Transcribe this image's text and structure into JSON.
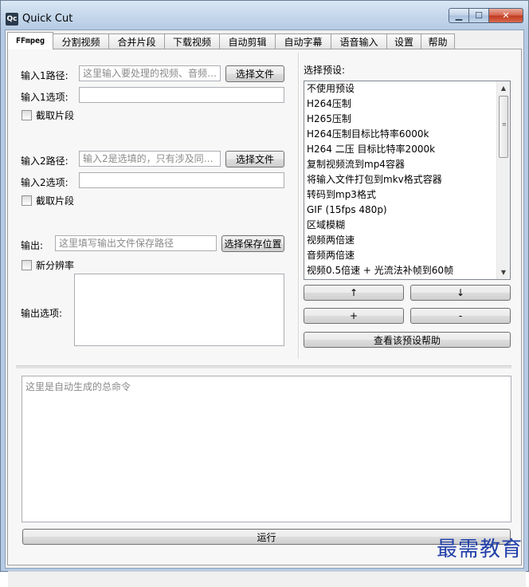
{
  "window": {
    "title": "Quick Cut",
    "app_icon": "Qc",
    "controls": {
      "minimize": "▁",
      "maximize": "☐",
      "close": "✕"
    }
  },
  "tabs": [
    {
      "label": "FFmpeg"
    },
    {
      "label": "分割视频"
    },
    {
      "label": "合并片段"
    },
    {
      "label": "下载视频"
    },
    {
      "label": "自动剪辑"
    },
    {
      "label": "自动字幕"
    },
    {
      "label": "语音输入"
    },
    {
      "label": "设置"
    },
    {
      "label": "帮助"
    }
  ],
  "input1": {
    "path_label": "输入1路径:",
    "path_placeholder": "这里输入要处理的视频、音频…",
    "choose_button": "选择文件",
    "options_label": "输入1选项:",
    "options_value": "",
    "clip_checkbox": "截取片段",
    "clip_checked": false
  },
  "input2": {
    "path_label": "输入2路径:",
    "path_placeholder": "输入2是选填的，只有涉及同…",
    "choose_button": "选择文件",
    "options_label": "输入2选项:",
    "options_value": "",
    "clip_checkbox": "截取片段",
    "clip_checked": false
  },
  "output": {
    "label": "输出:",
    "path_placeholder": "这里填写输出文件保存路径",
    "save_button": "选择保存位置",
    "new_resolution_checkbox": "新分辨率",
    "new_resolution_checked": false,
    "options_label": "输出选项:",
    "options_value": ""
  },
  "presets": {
    "label": "选择预设:",
    "items": [
      "不使用预设",
      "H264压制",
      "H265压制",
      "H264压制目标比特率6000k",
      "H264 二压 目标比特率2000k",
      "复制视频流到mp4容器",
      "将输入文件打包到mkv格式容器",
      "转码到mp3格式",
      "GIF (15fps 480p)",
      "区域模糊",
      "视频两倍速",
      "音频两倍速",
      "视频0.5倍速 + 光流法补帧到60帧"
    ],
    "scroll": {
      "up": "▲",
      "down": "▼",
      "grip": "≡"
    },
    "move_up_button": "↑",
    "move_down_button": "↓",
    "add_button": "+",
    "remove_button": "-",
    "help_button": "查看该预设帮助"
  },
  "command": {
    "placeholder": "这里是自动生成的总命令",
    "value": ""
  },
  "run_button": "运行",
  "watermark": "最需教育"
}
